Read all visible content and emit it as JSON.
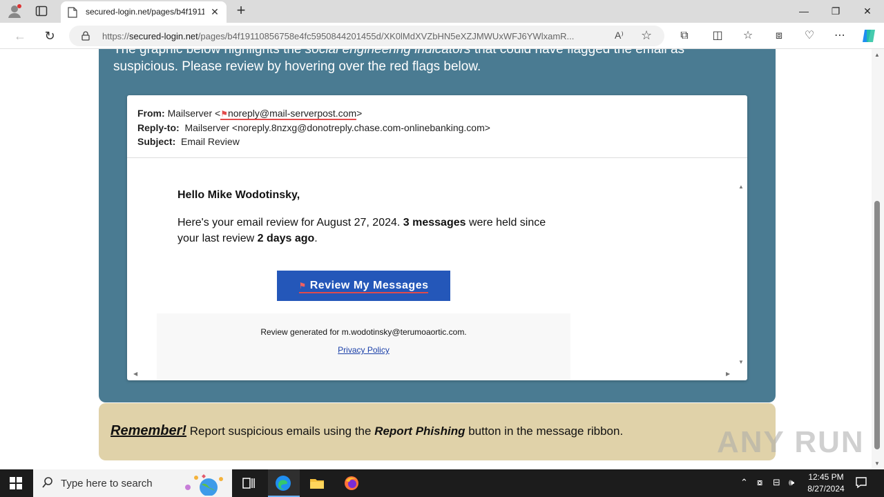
{
  "browser": {
    "tab_title": "secured-login.net/pages/b4f1911",
    "url_scheme": "https://",
    "url_host": "secured-login.net",
    "url_path": "/pages/b4f19110856758e4fc5950844201455d/XK0lMdXVZbHN5eXZJMWUxWFJ6YWlxamR..."
  },
  "lesson": {
    "intro_line1_start": "The graphic below highlights the ",
    "intro_line1_em": "social engineering indicators",
    "intro_line1_end": " that could have flagged the email as",
    "intro_line2": "suspicious. Please review by hovering over the red flags below."
  },
  "email": {
    "from_label": "From:",
    "from_name": "Mailserver <",
    "from_address": "noreply@mail-serverpost.com",
    "from_close": ">",
    "replyto_label": "Reply-to:",
    "replyto_value": "Mailserver <noreply.8nzxg@donotreply.chase.com-onlinebanking.com>",
    "subject_label": "Subject:",
    "subject_value": "Email Review",
    "greeting": "Hello Mike Wodotinsky,",
    "body_part1": "Here's your email review for August 27, 2024. ",
    "body_bold1": "3 messages",
    "body_part2": " were held since your last review ",
    "body_bold2": "2 days ago",
    "body_part3": ".",
    "cta_label": "Review My Messages",
    "footer": "Review generated for m.wodotinsky@terumoaortic.com.",
    "privacy_link": "Privacy Policy"
  },
  "reminder": {
    "remember": "Remember!",
    "text1": " Report suspicious emails using the ",
    "report_phishing": "Report Phishing",
    "text2": " button in the message ribbon."
  },
  "watermark": "ANY RUN",
  "taskbar": {
    "search_placeholder": "Type here to search",
    "time": "12:45 PM",
    "date": "8/27/2024"
  },
  "colors": {
    "panel_blue": "#4a7b92",
    "panel_tan": "#e0d2a9",
    "cta_blue": "#2457b9",
    "flag_red": "#e24a4a"
  }
}
